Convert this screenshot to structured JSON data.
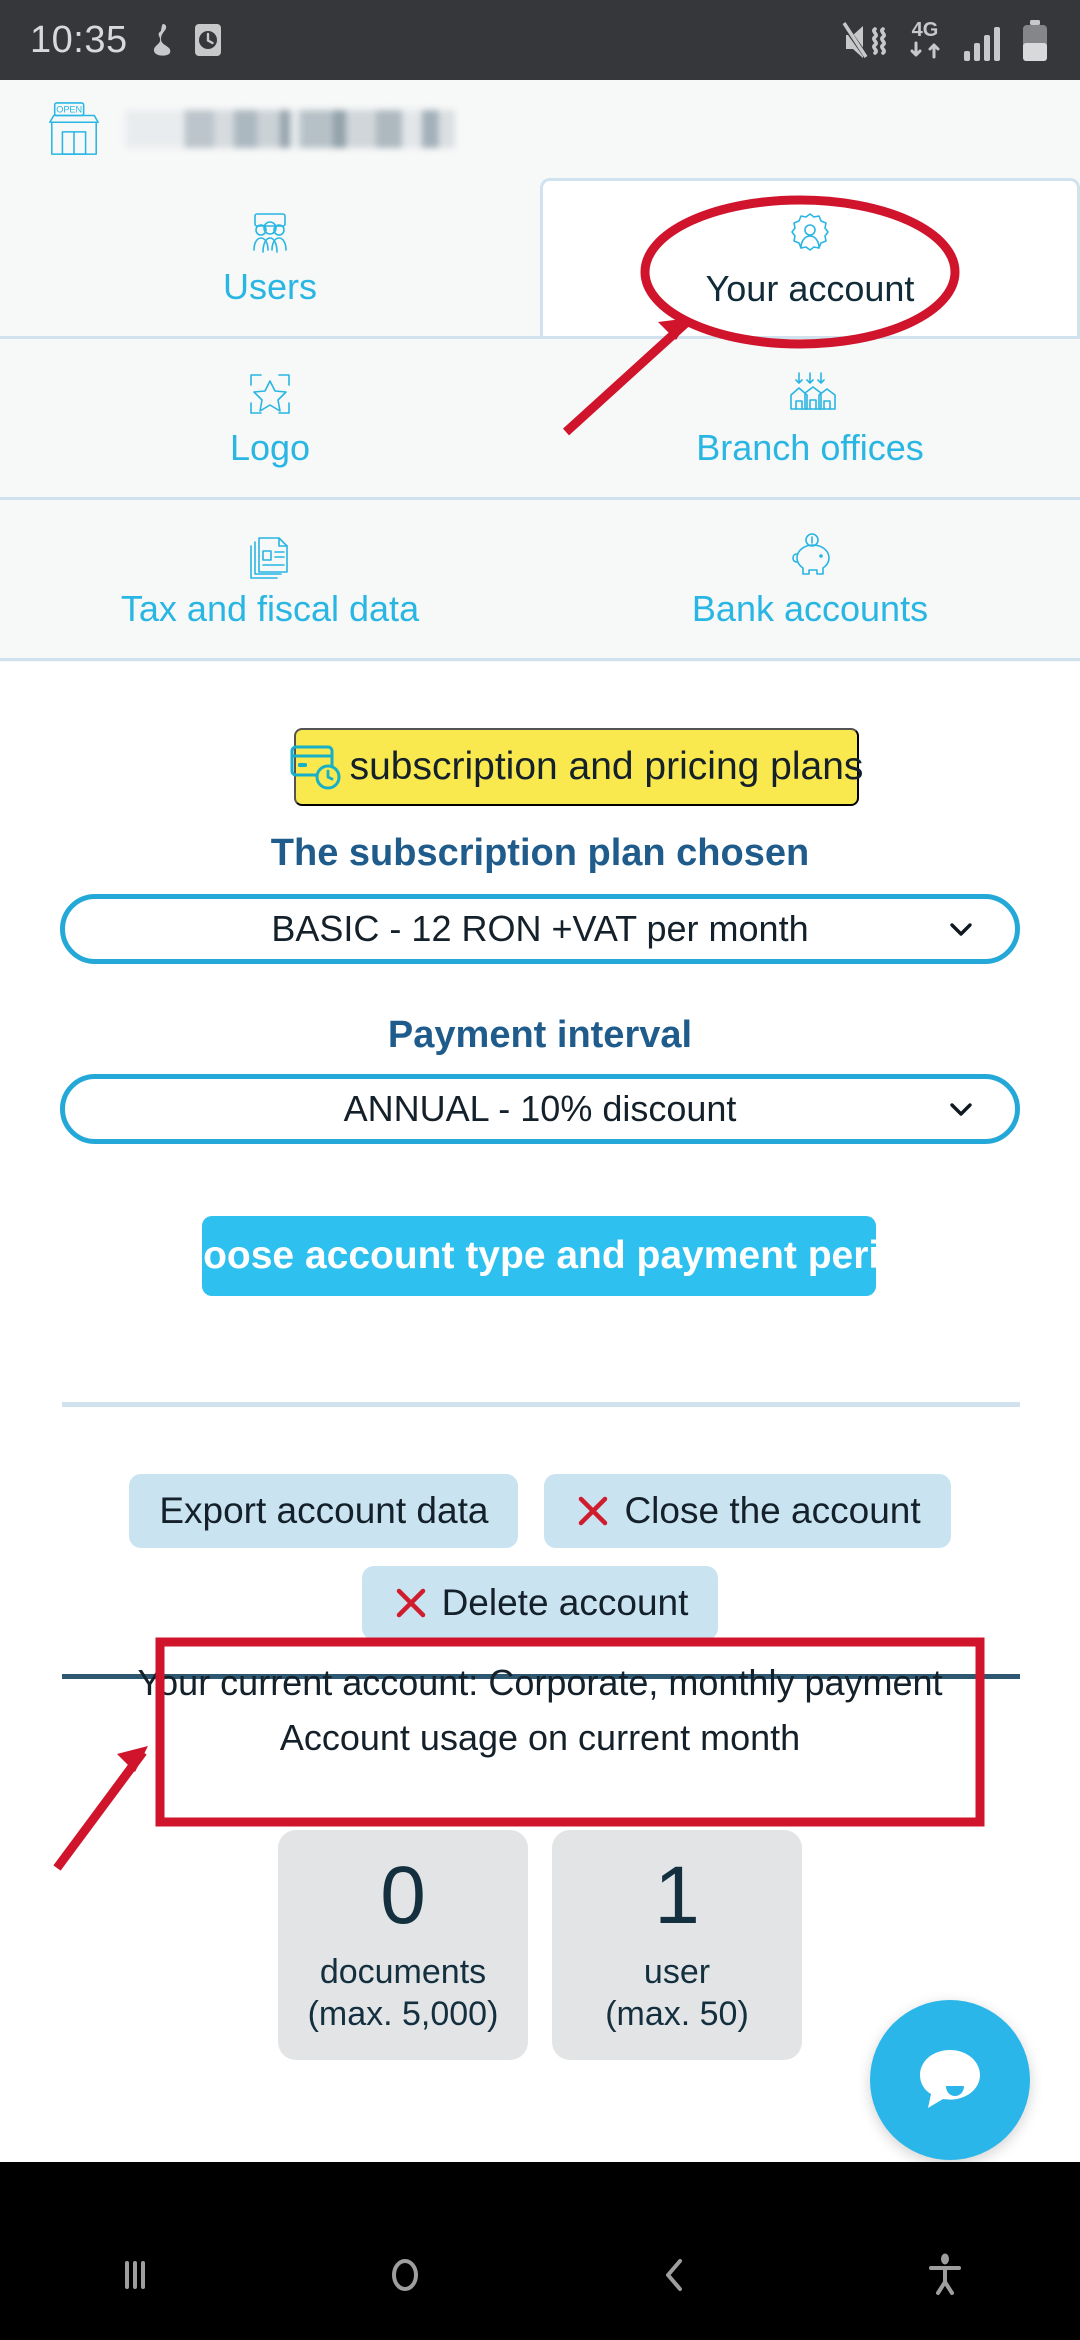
{
  "status_bar": {
    "time": "10:35",
    "icons_left": [
      "do-not-disturb-icon",
      "clock-icon"
    ],
    "icons_right": [
      "mute-vibrate-icon",
      "network-4g-icon",
      "signal-bars-icon",
      "battery-icon"
    ],
    "network_label": "4G"
  },
  "app_header": {
    "shop_icon": "shop-open-icon",
    "shop_icon_label": "OPEN",
    "company_name_redacted": true
  },
  "tabs": [
    {
      "label": "Users",
      "icon": "users-group-icon",
      "active": false
    },
    {
      "label": "Your account",
      "icon": "gear-person-icon",
      "active": true
    },
    {
      "label": "Logo",
      "icon": "logo-resize-icon",
      "active": false
    },
    {
      "label": "Branch offices",
      "icon": "branch-offices-icon",
      "active": false
    },
    {
      "label": "Tax and fiscal data",
      "icon": "tax-document-icon",
      "active": false
    },
    {
      "label": "Bank accounts",
      "icon": "piggy-bank-icon",
      "active": false
    }
  ],
  "main": {
    "subscription_banner": {
      "label": "subscription and pricing plans",
      "icon": "credit-card-clock-icon",
      "background": "#f9e94e"
    },
    "plan_section": {
      "title": "The subscription plan chosen",
      "selected": "BASIC - 12 RON +VAT per month"
    },
    "interval_section": {
      "title": "Payment interval",
      "selected": "ANNUAL - 10% discount"
    },
    "cta_button": {
      "label": "Choose account type and payment period",
      "background": "#2ec0ee"
    },
    "actions": [
      {
        "label": "Export account data",
        "icon": null
      },
      {
        "label": "Close the account",
        "icon": "x-mark-icon"
      },
      {
        "label": "Delete account",
        "icon": "x-mark-icon"
      }
    ],
    "current_account_line": "Your current account: Corporate, monthly payment",
    "usage_heading": "Account usage on current month",
    "usage_cards": [
      {
        "value": "0",
        "unit": "documents",
        "max": "(max. 5,000)"
      },
      {
        "value": "1",
        "unit": "user",
        "max": "(max. 50)"
      }
    ],
    "chat_fab": {
      "icon": "chat-bubble-icon",
      "background": "#2ab6e8"
    }
  },
  "annotations": {
    "color": "#cf142b",
    "items": [
      {
        "type": "ellipse",
        "target": "Your account tab"
      },
      {
        "type": "arrow",
        "target": "Your account tab"
      },
      {
        "type": "rect",
        "target": "current account / usage heading block"
      },
      {
        "type": "arrow",
        "target": "current account / usage heading block"
      }
    ]
  },
  "nav_bar": {
    "buttons": [
      {
        "name": "recents",
        "icon": "recents-icon"
      },
      {
        "name": "home",
        "icon": "home-circle-icon"
      },
      {
        "name": "back",
        "icon": "back-chevron-icon"
      },
      {
        "name": "accessibility",
        "icon": "accessibility-icon"
      }
    ]
  }
}
